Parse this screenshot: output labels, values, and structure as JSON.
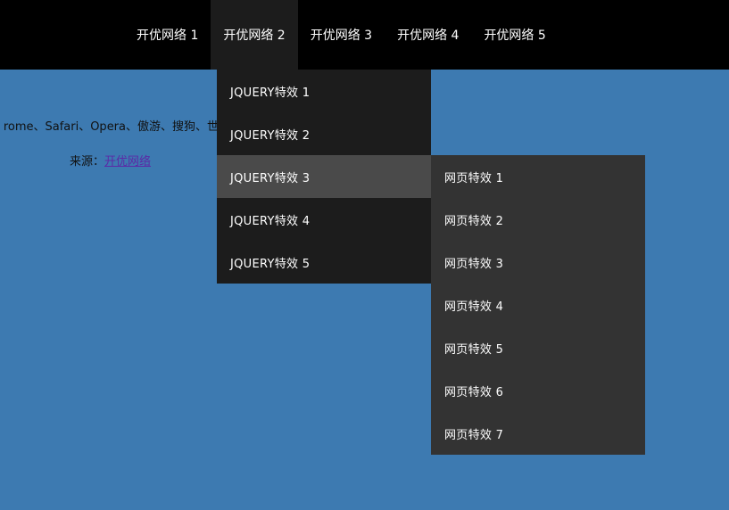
{
  "nav": {
    "items": [
      {
        "label": "开优网络 1"
      },
      {
        "label": "开优网络 2"
      },
      {
        "label": "开优网络 3"
      },
      {
        "label": "开优网络 4"
      },
      {
        "label": "开优网络 5"
      }
    ],
    "active_index": 1
  },
  "content": {
    "description": "rome、Safari、Opera、傲游、搜狗、世",
    "source_prefix": "来源：",
    "source_link": "开优网络"
  },
  "submenu": {
    "items": [
      {
        "label": "JQUERY特效 1"
      },
      {
        "label": "JQUERY特效 2"
      },
      {
        "label": "JQUERY特效 3"
      },
      {
        "label": "JQUERY特效 4"
      },
      {
        "label": "JQUERY特效 5"
      }
    ],
    "active_index": 2
  },
  "subsubmenu": {
    "items": [
      {
        "label": "网页特效 1"
      },
      {
        "label": "网页特效 2"
      },
      {
        "label": "网页特效 3"
      },
      {
        "label": "网页特效 4"
      },
      {
        "label": "网页特效 5"
      },
      {
        "label": "网页特效 6"
      },
      {
        "label": "网页特效 7"
      }
    ]
  },
  "colors": {
    "page_background": "#3d7ab1",
    "navbar_background": "#000000",
    "submenu_background": "#1c1c1c",
    "submenu_active": "#4a4a4a",
    "subsubmenu_background": "#333333",
    "link": "#5b2aa6"
  }
}
